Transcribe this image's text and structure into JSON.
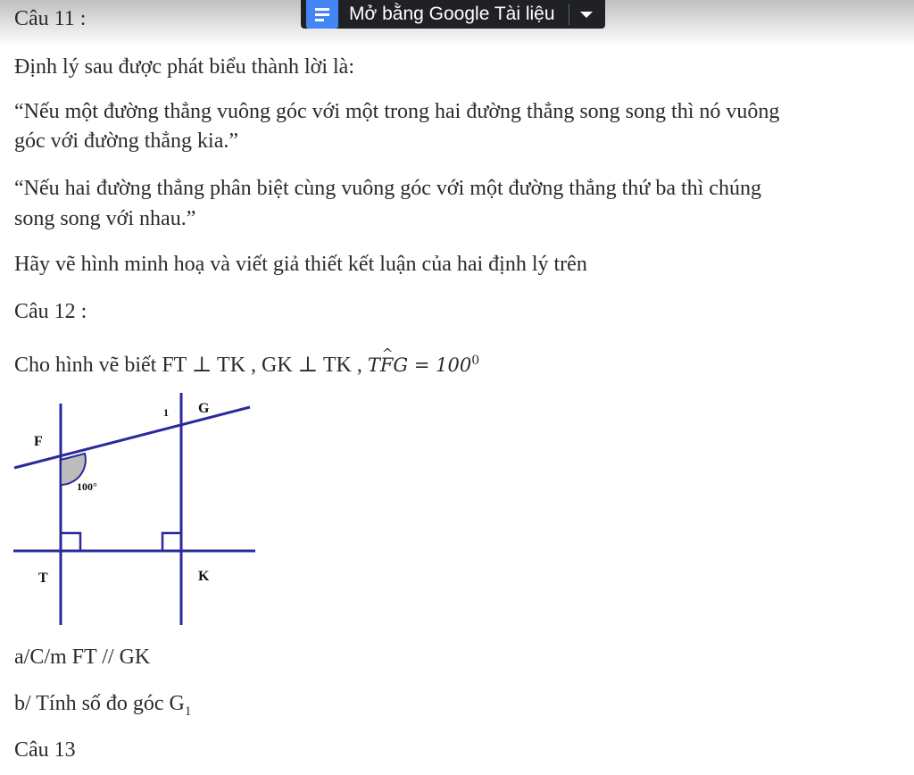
{
  "toolbar": {
    "open_label": "Mở bằng Google Tài liệu",
    "icon": "google-docs-icon"
  },
  "colors": {
    "figure_line": "#2a2a9a",
    "angle_fill": "#bcbcbc",
    "toolbar_bg": "#202124"
  },
  "q11": {
    "title": "Câu 11 :",
    "intro": "Định lý sau được phát biểu thành lời là:",
    "theorem1_line1": "“Nếu một đường thẳng vuông góc với một trong hai đường thẳng song song thì nó vuông",
    "theorem1_line2": "góc với đường thẳng kia.”",
    "theorem2_line1": "“Nếu hai đường thẳng phân biệt cùng vuông góc với một đường thẳng thứ ba thì chúng",
    "theorem2_line2": "song song với nhau.”",
    "task": "Hãy vẽ hình minh hoạ và viết giả thiết kết luận của hai định lý trên"
  },
  "q12": {
    "title": "Câu 12 :",
    "given_prefix": "Cho hình vẽ  biết FT ⊥ TK , GK ⊥ TK , ",
    "angle_T": "T",
    "angle_F": "F",
    "angle_G": "G",
    "angle_eq": " = 100",
    "angle_deg": "0",
    "figure": {
      "label_F": "F",
      "label_G": "G",
      "label_1": "1",
      "label_T": "T",
      "label_K": "K",
      "angle_label": "100°"
    },
    "part_a": "a/C/m  FT // GK",
    "part_b_prefix": "b/ Tính số đo góc G",
    "part_b_sub": "1"
  },
  "q13": {
    "title": "Câu 13"
  }
}
